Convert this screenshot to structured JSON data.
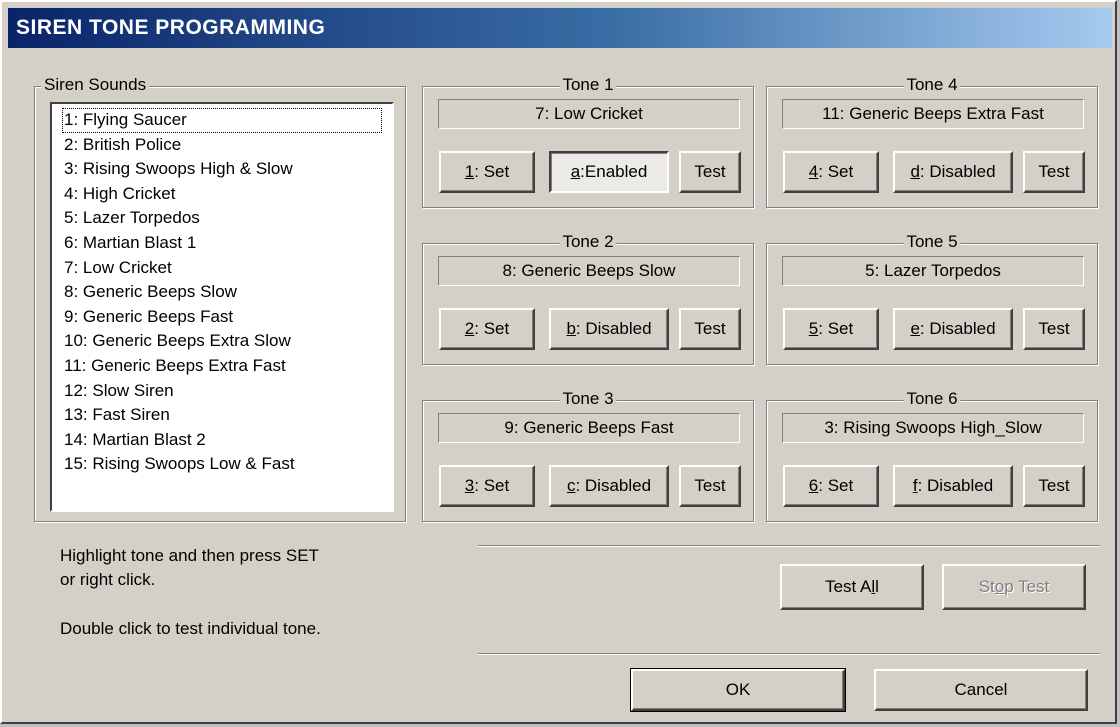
{
  "window": {
    "title": "SIREN TONE PROGRAMMING"
  },
  "siren_sounds": {
    "label": "Siren Sounds",
    "selected_index": 0,
    "items": [
      "1: Flying Saucer",
      "2: British Police",
      "3: Rising Swoops High & Slow",
      "4: High Cricket",
      "5: Lazer Torpedos",
      "6: Martian Blast 1",
      "7: Low Cricket",
      "8: Generic Beeps Slow",
      "9: Generic Beeps Fast",
      "10: Generic Beeps Extra Slow",
      "11: Generic Beeps Extra Fast",
      "12: Slow Siren",
      "13: Fast Siren",
      "14: Martian Blast 2",
      "15: Rising Swoops Low & Fast"
    ]
  },
  "tones": [
    {
      "title": "Tone 1",
      "value": "7: Low Cricket",
      "set_key": "1",
      "set_rest": ": Set",
      "enable_key": "a",
      "enable_rest": ":Enabled",
      "enabled": true,
      "test_label": "Test"
    },
    {
      "title": "Tone 2",
      "value": "8: Generic Beeps Slow",
      "set_key": "2",
      "set_rest": ": Set",
      "enable_key": "b",
      "enable_rest": ": Disabled",
      "enabled": false,
      "test_label": "Test"
    },
    {
      "title": "Tone 3",
      "value": "9: Generic Beeps Fast",
      "set_key": "3",
      "set_rest": ": Set",
      "enable_key": "c",
      "enable_rest": ": Disabled",
      "enabled": false,
      "test_label": "Test"
    },
    {
      "title": "Tone 4",
      "value": "11: Generic Beeps Extra Fast",
      "set_key": "4",
      "set_rest": ": Set",
      "enable_key": "d",
      "enable_rest": ": Disabled",
      "enabled": false,
      "test_label": "Test"
    },
    {
      "title": "Tone 5",
      "value": "5: Lazer Torpedos",
      "set_key": "5",
      "set_rest": ": Set",
      "enable_key": "e",
      "enable_rest": ": Disabled",
      "enabled": false,
      "test_label": "Test"
    },
    {
      "title": "Tone 6",
      "value": "3: Rising Swoops High_Slow",
      "set_key": "6",
      "set_rest": ": Set",
      "enable_key": "f",
      "enable_rest": ": Disabled",
      "enabled": false,
      "test_label": "Test"
    }
  ],
  "help": {
    "line1": "Highlight tone and then press SET",
    "line2": "or right click.",
    "line3": "Double click to test individual tone."
  },
  "buttons": {
    "test_all_pre": "Test A",
    "test_all_key": "l",
    "test_all_post": "l",
    "stop_test_pre": "St",
    "stop_test_key": "o",
    "stop_test_post": "p Test",
    "ok": "OK",
    "cancel": "Cancel"
  }
}
